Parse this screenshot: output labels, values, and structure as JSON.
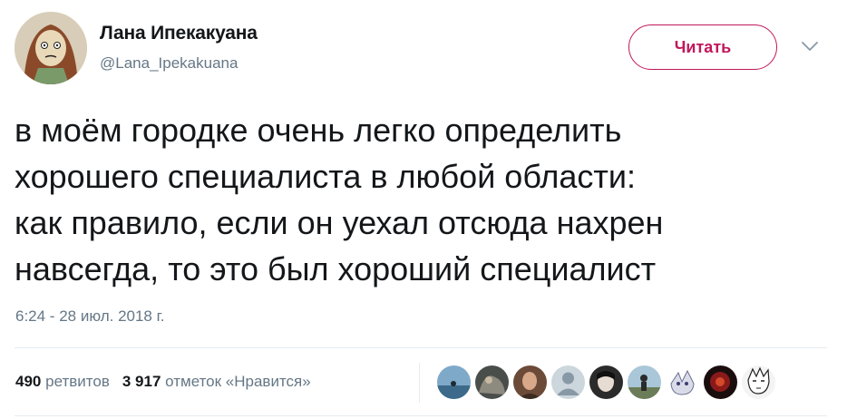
{
  "tweet": {
    "author_name": "Лана Ипекакуана",
    "author_handle": "@Lana_Ipekakuana",
    "follow_label": "Читать",
    "text_lines": [
      "в моём городке очень легко определить",
      "хорошего специалиста в любой области:",
      "как правило, если он уехал отсюда нахрен",
      "навсегда, то это был хороший специалист"
    ],
    "timestamp": "6:24 - 28 июл. 2018 г.",
    "retweets_count": "490",
    "retweets_label": "ретвитов",
    "likes_count": "3 917",
    "likes_label": "отметок «Нравится»"
  },
  "colors": {
    "follow_accent": "#c2185b",
    "secondary_text": "#657786",
    "primary_text": "#14171a",
    "divider": "#e6ecf0"
  },
  "icons": {
    "menu": "chevron-down-icon"
  }
}
